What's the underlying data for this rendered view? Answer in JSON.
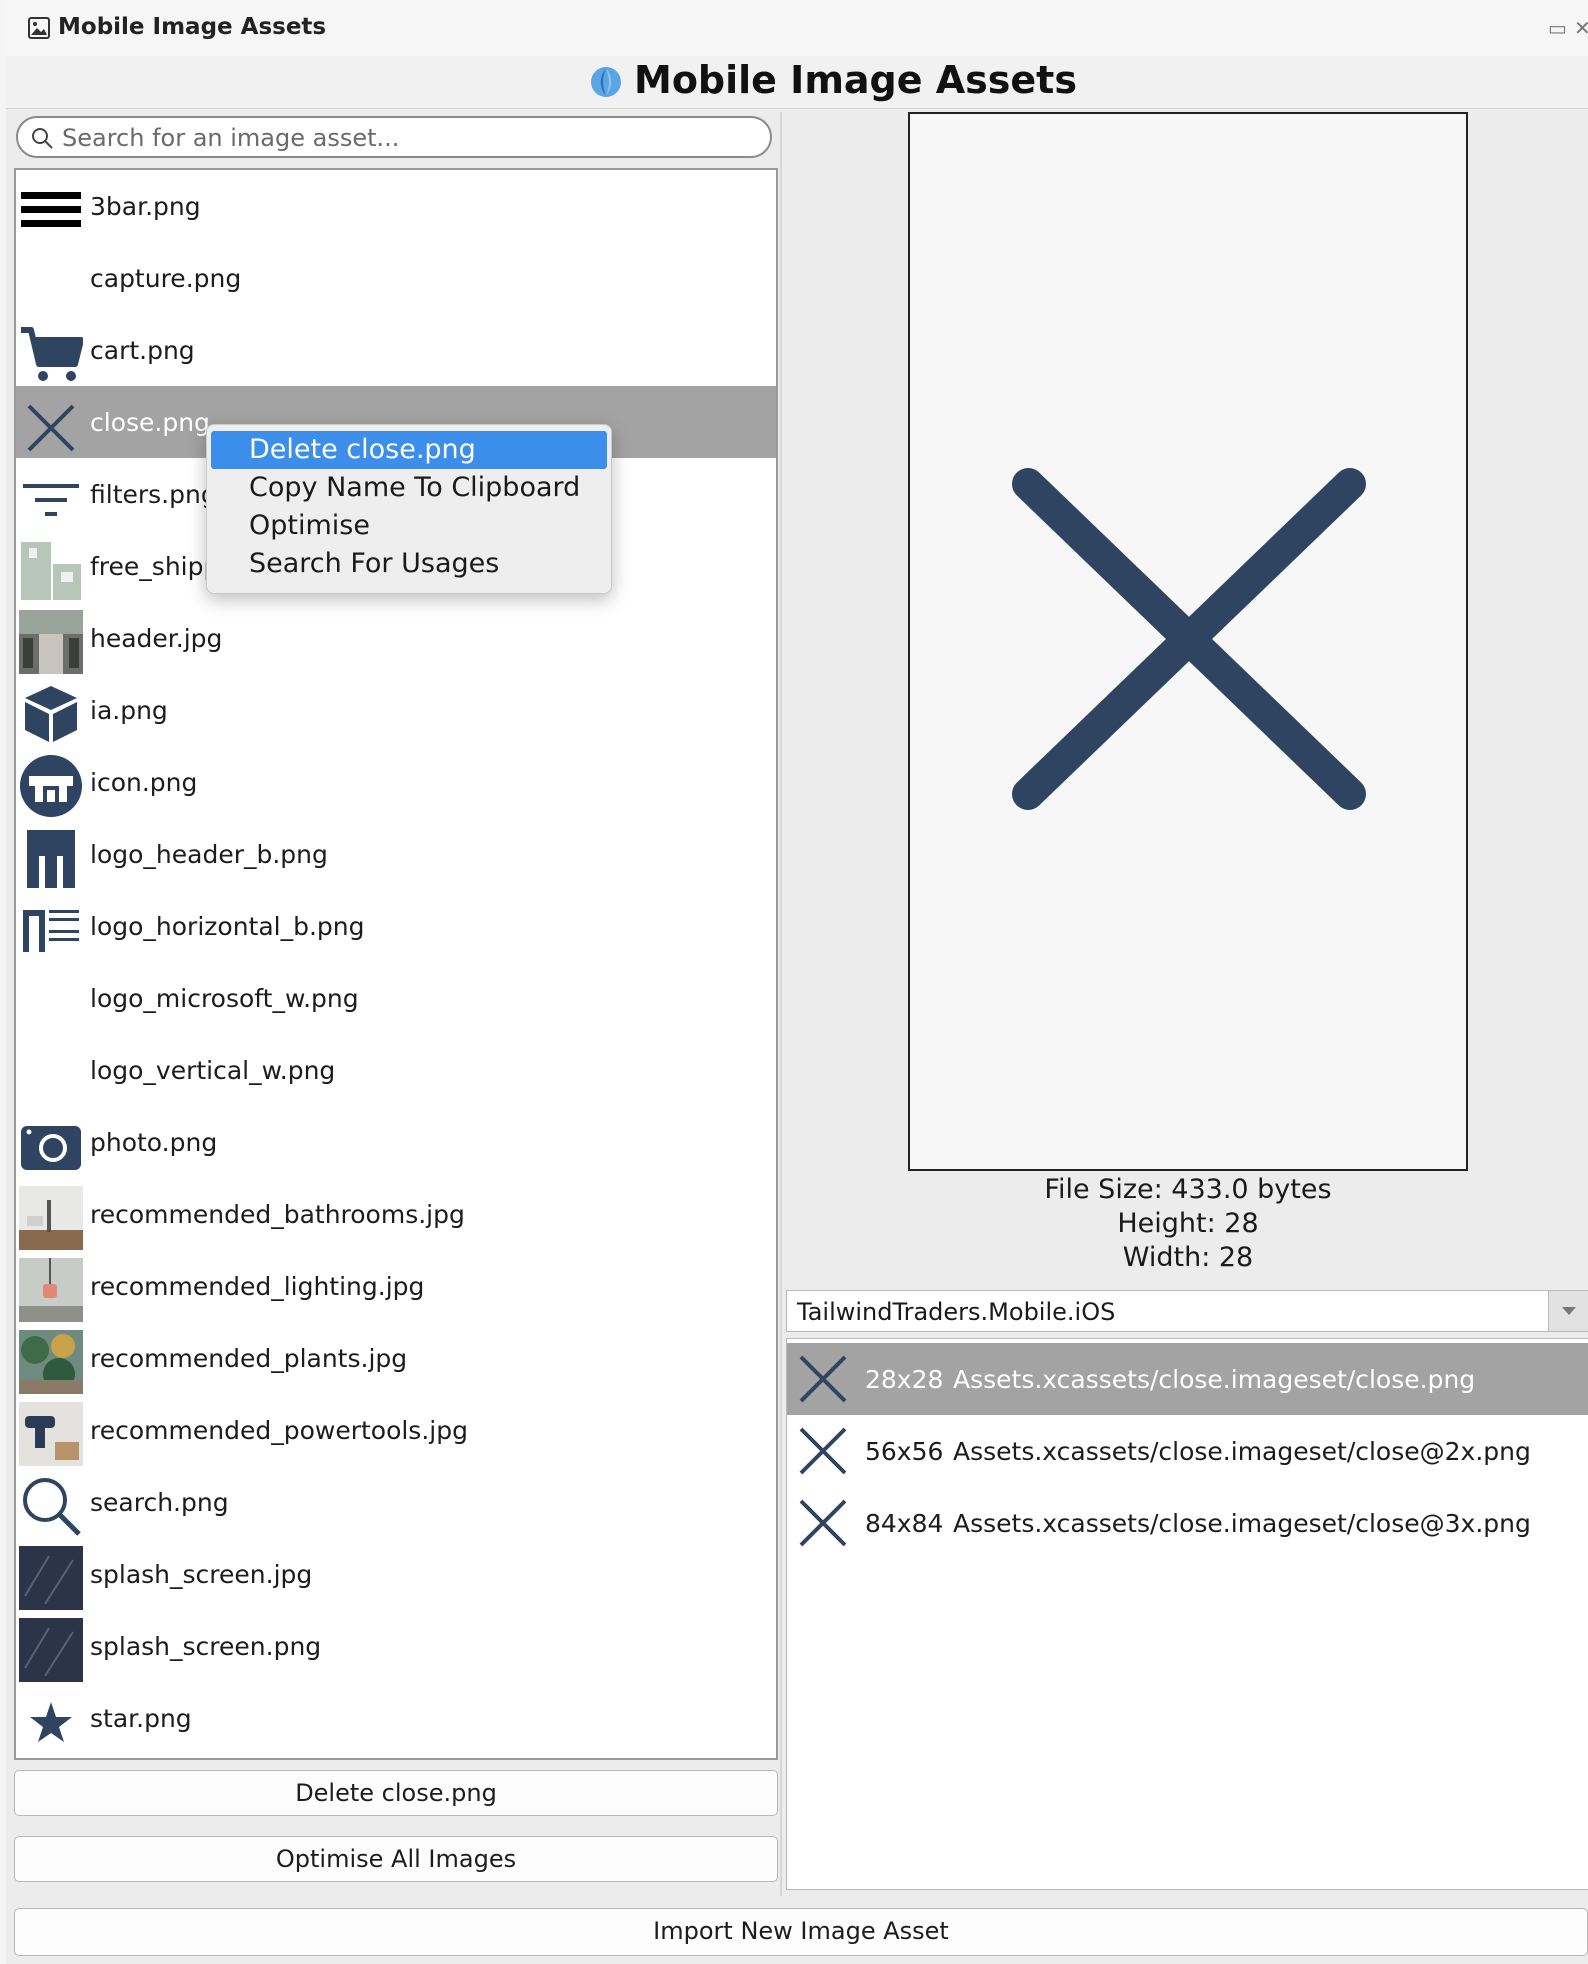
{
  "window": {
    "title": "Mobile Image Assets"
  },
  "header": {
    "title": "Mobile Image Assets"
  },
  "search": {
    "placeholder": "Search for an image asset..."
  },
  "assets": [
    {
      "name": "3bar.png",
      "icon": "three-bar-icon"
    },
    {
      "name": "capture.png",
      "icon": "blank"
    },
    {
      "name": "cart.png",
      "icon": "cart-icon"
    },
    {
      "name": "close.png",
      "icon": "close-icon",
      "selected": true
    },
    {
      "name": "filters.png",
      "icon": "filter-icon"
    },
    {
      "name": "free_shipp",
      "icon": "free-shipping-icon"
    },
    {
      "name": "header.jpg",
      "icon": "header-photo-thumb"
    },
    {
      "name": "ia.png",
      "icon": "box-icon"
    },
    {
      "name": "icon.png",
      "icon": "store-round-icon"
    },
    {
      "name": "logo_header_b.png",
      "icon": "logo-header-icon"
    },
    {
      "name": "logo_horizontal_b.png",
      "icon": "logo-horizontal-icon"
    },
    {
      "name": "logo_microsoft_w.png",
      "icon": "blank"
    },
    {
      "name": "logo_vertical_w.png",
      "icon": "blank"
    },
    {
      "name": "photo.png",
      "icon": "camera-icon"
    },
    {
      "name": "recommended_bathrooms.jpg",
      "icon": "bathroom-photo-thumb"
    },
    {
      "name": "recommended_lighting.jpg",
      "icon": "lighting-photo-thumb"
    },
    {
      "name": "recommended_plants.jpg",
      "icon": "plants-photo-thumb"
    },
    {
      "name": "recommended_powertools.jpg",
      "icon": "powertools-photo-thumb"
    },
    {
      "name": "search.png",
      "icon": "magnifier-icon"
    },
    {
      "name": "splash_screen.jpg",
      "icon": "splash-photo-thumb"
    },
    {
      "name": "splash_screen.png",
      "icon": "splash-photo-thumb"
    },
    {
      "name": "star.png",
      "icon": "star-icon"
    }
  ],
  "context_menu": {
    "items": [
      "Delete close.png",
      "Copy Name To Clipboard",
      "Optimise",
      "Search For Usages"
    ],
    "active_index": 0
  },
  "buttons": {
    "delete": "Delete close.png",
    "optimise_all": "Optimise All Images",
    "import": "Import New Image Asset"
  },
  "details": {
    "file_size": "File Size: 433.0 bytes",
    "height": "Height: 28",
    "width": "Width:  28"
  },
  "project_select": {
    "value": "TailwindTraders.Mobile.iOS"
  },
  "variants": [
    {
      "dim": "28x28",
      "path": "Assets.xcassets/close.imageset/close.png",
      "selected": true
    },
    {
      "dim": "56x56",
      "path": "Assets.xcassets/close.imageset/close@2x.png"
    },
    {
      "dim": "84x84",
      "path": "Assets.xcassets/close.imageset/close@3x.png"
    }
  ],
  "colors": {
    "icon_navy": "#2f4460",
    "selection_gray": "#a3a3a3",
    "menu_highlight": "#3b8eea"
  }
}
